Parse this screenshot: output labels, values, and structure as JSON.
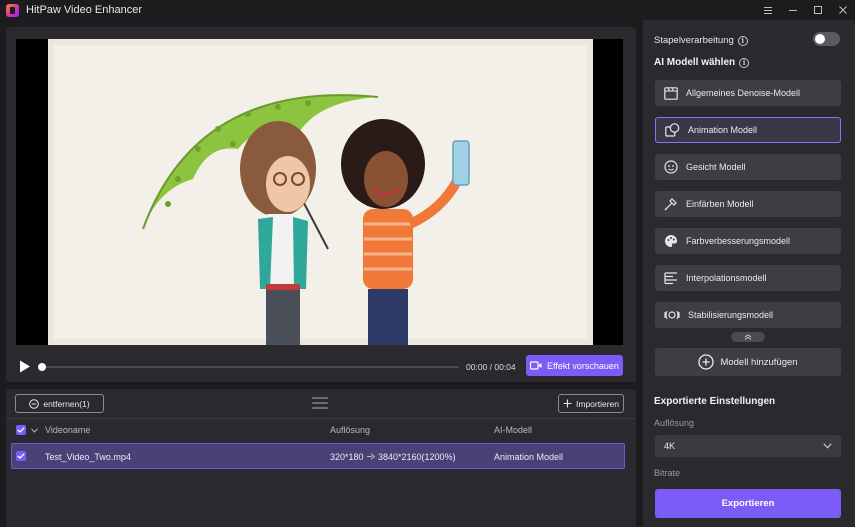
{
  "window": {
    "title": "HitPaw Video Enhancer",
    "controls": [
      "menu-icon",
      "minimize-icon",
      "maximize-icon",
      "close-icon"
    ]
  },
  "player": {
    "time": "00:00 / 00:04",
    "progress": 0,
    "preview_button": "Effekt vorschauen"
  },
  "list": {
    "remove_button": "entfernen(1)",
    "import_button": "Importieren",
    "columns": {
      "name": "Videoname",
      "resolution": "Auflösung",
      "model": "AI-Modell"
    },
    "rows": [
      {
        "checked": true,
        "name": "Test_Video_Two.mp4",
        "res_from": "320*180",
        "res_to": "3840*2160(1200%)",
        "model": "Animation Modell"
      }
    ]
  },
  "sidebar": {
    "batch_label": "Stapelverarbeitung",
    "batch_enabled": false,
    "model_section_title": "AI Modell wählen",
    "models": [
      {
        "label": "Allgemeines Denoise-Modell",
        "icon": "film-icon",
        "selected": false
      },
      {
        "label": "Animation Modell",
        "icon": "animation-icon",
        "selected": true
      },
      {
        "label": "Gesicht Modell",
        "icon": "face-icon",
        "selected": false
      },
      {
        "label": "Einfärben Modell",
        "icon": "colorize-icon",
        "selected": false
      },
      {
        "label": "Farbverbesserungsmodell",
        "icon": "palette-icon",
        "selected": false
      },
      {
        "label": "Interpolationsmodell",
        "icon": "interpolation-icon",
        "selected": false
      },
      {
        "label": "Stabilisierungsmodell",
        "icon": "stabilize-icon",
        "selected": false
      }
    ],
    "add_model_button": "Modell hinzufügen",
    "export_section_title": "Exportierte Einstellungen",
    "resolution_label": "Auflösung",
    "resolution_value": "4K",
    "bitrate_label": "Bitrate",
    "export_button": "Exportieren"
  },
  "colors": {
    "accent": "#7b5cf6",
    "background": "#1c1c1f",
    "panel": "#2a2a2e",
    "selected_row": "#4a4178"
  }
}
